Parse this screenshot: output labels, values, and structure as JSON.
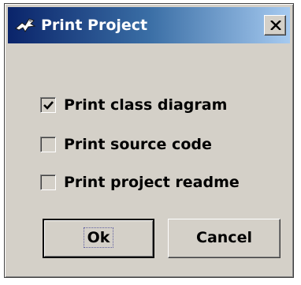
{
  "window": {
    "title": "Print Project"
  },
  "options": [
    {
      "label": "Print class diagram",
      "checked": true
    },
    {
      "label": "Print source code",
      "checked": false
    },
    {
      "label": "Print project readme",
      "checked": false
    }
  ],
  "buttons": {
    "ok_label": "Ok",
    "cancel_label": "Cancel"
  },
  "icons": {
    "title": "bluej-bird-icon",
    "close": "close-x-icon",
    "check": "checkmark-icon"
  },
  "colors": {
    "titlebar_start": "#0a246a",
    "titlebar_end": "#a6caf0",
    "dialog_background": "#d4d0c8"
  }
}
